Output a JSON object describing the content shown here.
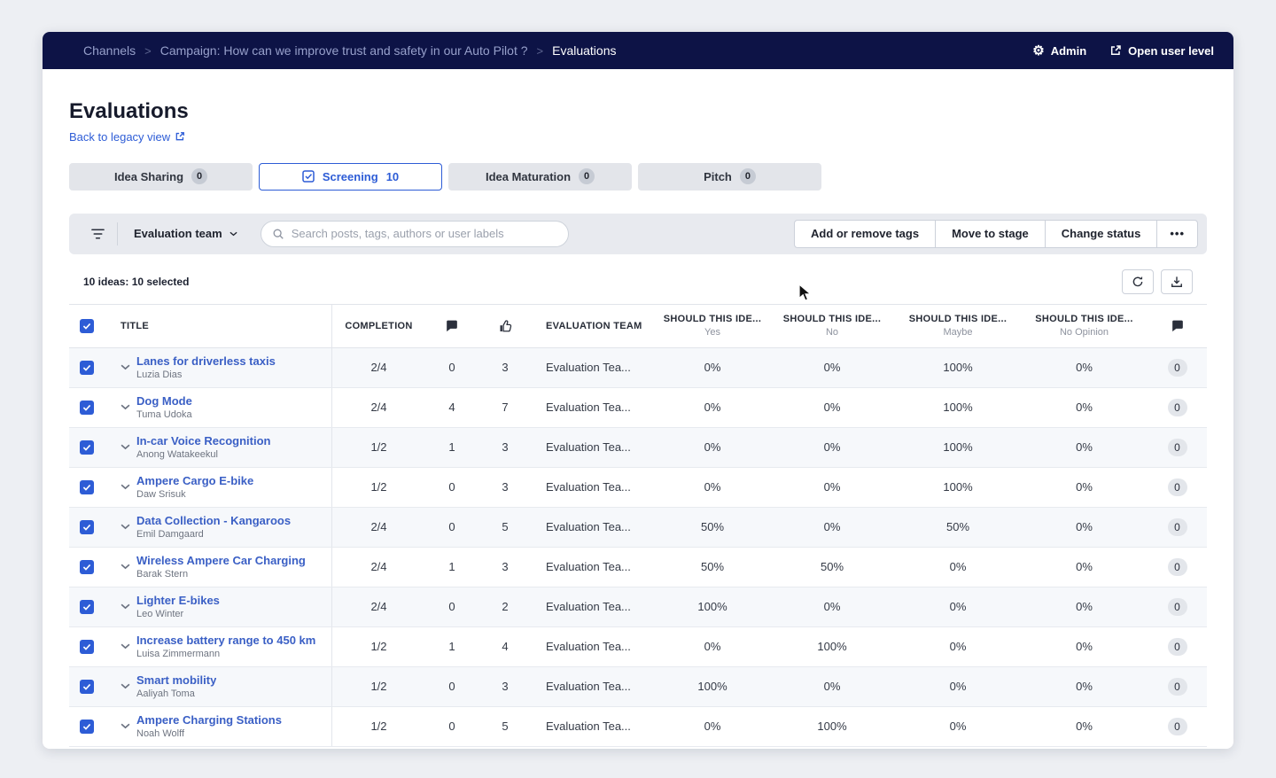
{
  "topbar": {
    "breadcrumb": [
      "Channels",
      "Campaign: How can we improve trust and safety in our Auto Pilot ?",
      "Evaluations"
    ],
    "separator": ">",
    "admin_label": "Admin",
    "open_user_level_label": "Open user level"
  },
  "page": {
    "title": "Evaluations",
    "back_link_label": "Back to legacy view"
  },
  "tabs": [
    {
      "label": "Idea Sharing",
      "count": "0"
    },
    {
      "label": "Screening",
      "count": "10"
    },
    {
      "label": "Idea Maturation",
      "count": "0"
    },
    {
      "label": "Pitch",
      "count": "0"
    }
  ],
  "toolbar": {
    "team_dropdown_label": "Evaluation team",
    "search_placeholder": "Search posts, tags, authors or user labels",
    "actions": {
      "add_tags": "Add or remove tags",
      "move_stage": "Move to stage",
      "change_status": "Change status",
      "more": "•••"
    }
  },
  "table": {
    "summary": "10 ideas: 10 selected",
    "headers": {
      "title": "TITLE",
      "completion": "COMPLETION",
      "evaluation_team": "EVALUATION TEAM",
      "should": [
        {
          "label": "SHOULD THIS IDE...",
          "sub": "Yes"
        },
        {
          "label": "SHOULD THIS IDE...",
          "sub": "No"
        },
        {
          "label": "SHOULD THIS IDE...",
          "sub": "Maybe"
        },
        {
          "label": "SHOULD THIS IDE...",
          "sub": "No Opinion"
        }
      ]
    },
    "rows": [
      {
        "title": "Lanes for driverless taxis",
        "author": "Luzia Dias",
        "completion": "2/4",
        "comments": "0",
        "likes": "3",
        "team": "Evaluation Tea...",
        "yes": "0%",
        "no": "0%",
        "maybe": "100%",
        "no_opinion": "0%",
        "eval_comments": "0"
      },
      {
        "title": "Dog Mode",
        "author": "Tuma Udoka",
        "completion": "2/4",
        "comments": "4",
        "likes": "7",
        "team": "Evaluation Tea...",
        "yes": "0%",
        "no": "0%",
        "maybe": "100%",
        "no_opinion": "0%",
        "eval_comments": "0"
      },
      {
        "title": "In-car Voice Recognition",
        "author": "Anong Watakeekul",
        "completion": "1/2",
        "comments": "1",
        "likes": "3",
        "team": "Evaluation Tea...",
        "yes": "0%",
        "no": "0%",
        "maybe": "100%",
        "no_opinion": "0%",
        "eval_comments": "0"
      },
      {
        "title": "Ampere Cargo E-bike",
        "author": "Daw Srisuk",
        "completion": "1/2",
        "comments": "0",
        "likes": "3",
        "team": "Evaluation Tea...",
        "yes": "0%",
        "no": "0%",
        "maybe": "100%",
        "no_opinion": "0%",
        "eval_comments": "0"
      },
      {
        "title": "Data Collection - Kangaroos",
        "author": "Emil Damgaard",
        "completion": "2/4",
        "comments": "0",
        "likes": "5",
        "team": "Evaluation Tea...",
        "yes": "50%",
        "no": "0%",
        "maybe": "50%",
        "no_opinion": "0%",
        "eval_comments": "0"
      },
      {
        "title": "Wireless Ampere Car Charging",
        "author": "Barak Stern",
        "completion": "2/4",
        "comments": "1",
        "likes": "3",
        "team": "Evaluation Tea...",
        "yes": "50%",
        "no": "50%",
        "maybe": "0%",
        "no_opinion": "0%",
        "eval_comments": "0"
      },
      {
        "title": "Lighter E-bikes",
        "author": "Leo Winter",
        "completion": "2/4",
        "comments": "0",
        "likes": "2",
        "team": "Evaluation Tea...",
        "yes": "100%",
        "no": "0%",
        "maybe": "0%",
        "no_opinion": "0%",
        "eval_comments": "0"
      },
      {
        "title": "Increase battery range to 450 km",
        "author": "Luisa Zimmermann",
        "completion": "1/2",
        "comments": "1",
        "likes": "4",
        "team": "Evaluation Tea...",
        "yes": "0%",
        "no": "100%",
        "maybe": "0%",
        "no_opinion": "0%",
        "eval_comments": "0"
      },
      {
        "title": "Smart mobility",
        "author": "Aaliyah Toma",
        "completion": "1/2",
        "comments": "0",
        "likes": "3",
        "team": "Evaluation Tea...",
        "yes": "100%",
        "no": "0%",
        "maybe": "0%",
        "no_opinion": "0%",
        "eval_comments": "0"
      },
      {
        "title": "Ampere Charging Stations",
        "author": "Noah Wolff",
        "completion": "1/2",
        "comments": "0",
        "likes": "5",
        "team": "Evaluation Tea...",
        "yes": "0%",
        "no": "100%",
        "maybe": "0%",
        "no_opinion": "0%",
        "eval_comments": "0"
      }
    ]
  },
  "colors": {
    "accent_blue": "#2d5cd6",
    "topbar_navy": "#0d1346",
    "link_blue": "#3a5fc5"
  }
}
